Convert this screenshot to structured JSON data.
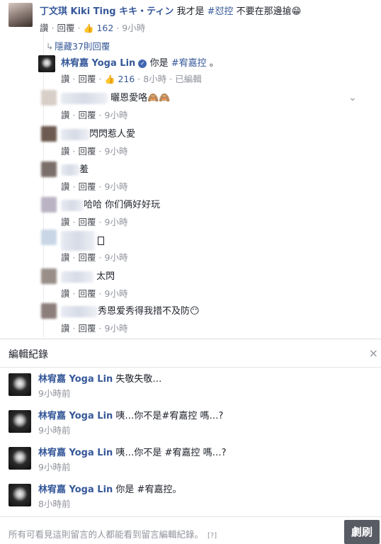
{
  "actions": {
    "like": "讚",
    "reply": "回覆",
    "sep": "·",
    "edited": "已編輯"
  },
  "top_comment": {
    "author": "丁文琪 Kiki Ting キキ・ティン",
    "text_before": "我才是",
    "hashtag": "#怼控",
    "text_after": "不要在那邊搶",
    "emoji": "😁",
    "likes": "162",
    "time": "9小時"
  },
  "hidden_replies": {
    "label": "隱藏37則回覆"
  },
  "replies": [
    {
      "author": "林宥嘉 Yoga Lin",
      "verified": true,
      "text_before": "你是",
      "hashtag": "#宥嘉控",
      "text_after": "。",
      "likes": "216",
      "time": "8小時",
      "edited": true
    },
    {
      "author": "",
      "text": "曬恩愛咯🙈🙈",
      "time": "9小時",
      "avatar_color": "#d8cfc8"
    },
    {
      "author": "",
      "text": "閃閃惹人愛",
      "time": "9小時",
      "avatar_color": "#6d5a50"
    },
    {
      "author": "",
      "text": "羞",
      "time": "9小時",
      "avatar_color": "#7b6f6a"
    },
    {
      "author": "",
      "text": "哈哈 你们俩好好玩",
      "time": "9小時",
      "avatar_color": "#b9b3c4"
    },
    {
      "author": "",
      "text": "",
      "time": "9小時",
      "avatar_color": "#c9d6e6"
    },
    {
      "author": "",
      "text": "太閃",
      "time": "9小時",
      "avatar_color": "#9a8f88"
    },
    {
      "author": "",
      "text": "秀恩爱秀得我措不及防😶",
      "time": "9小時",
      "avatar_color": "#8c7e7a"
    }
  ],
  "edit_history": {
    "title": "編輯紀錄",
    "close": "×",
    "entries": [
      {
        "author": "林宥嘉 Yoga Lin",
        "text": "失敬失敬…",
        "time": "9小時前"
      },
      {
        "author": "林宥嘉 Yoga Lin",
        "text": "咦…你不是#宥嘉控 嗎…?",
        "time": "9小時前"
      },
      {
        "author": "林宥嘉 Yoga Lin",
        "text": "咦…你不是 #宥嘉控 嗎…?",
        "time": "9小時前"
      },
      {
        "author": "林宥嘉 Yoga Lin",
        "text": "你是 #宥嘉控。",
        "time": "8小時前"
      }
    ],
    "footer": "所有可看見這則留言的人都能看到留言編輯紀錄。",
    "help": "[?]"
  },
  "watermark": "劇刷"
}
